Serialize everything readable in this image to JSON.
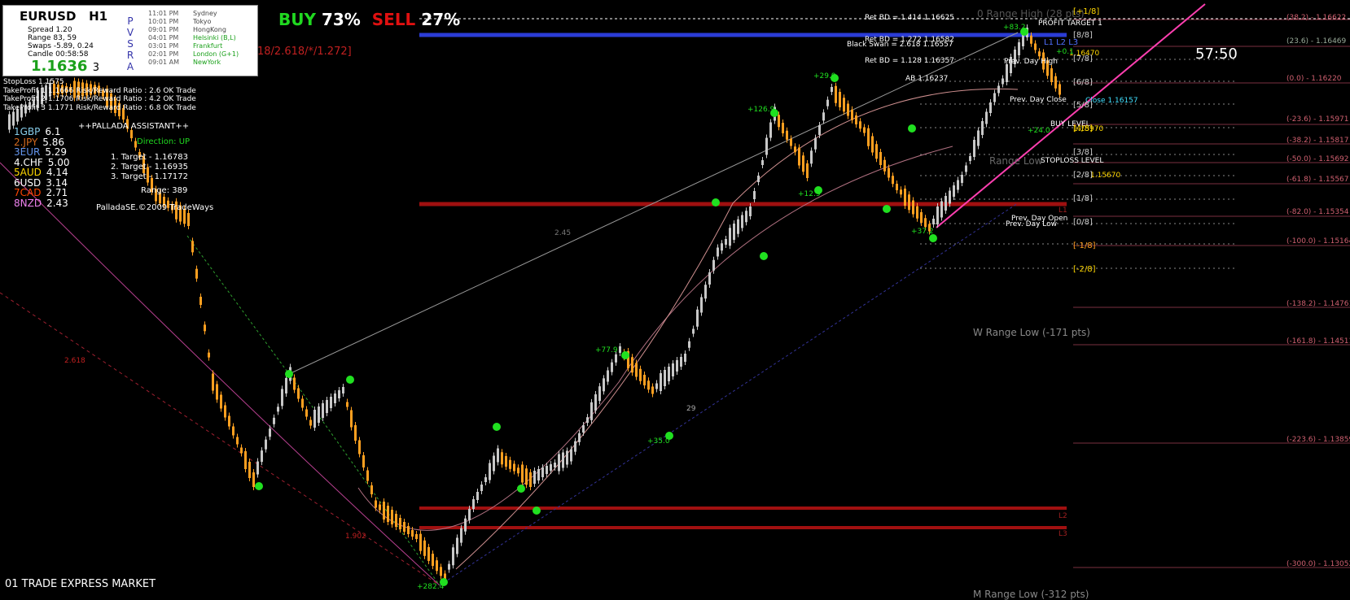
{
  "panel": {
    "symbol": "EURUSD",
    "timeframe": "H1",
    "spread": "Spread   1.20",
    "range": "Range    83, 59",
    "swaps": "Swaps   -5.89, 0.24",
    "candle": "Candle   00:58:58",
    "price": "1.1636",
    "price_digit": "3",
    "pvsra": [
      "P",
      "V",
      "S",
      "R",
      "A"
    ],
    "sessions": [
      {
        "time": "11:01 PM",
        "city": "Sydney",
        "color": "#444"
      },
      {
        "time": "10:01 PM",
        "city": "Tokyo",
        "color": "#444"
      },
      {
        "time": "09:01 PM",
        "city": "HongKong",
        "color": "#444"
      },
      {
        "time": "04:01 PM",
        "city": "Helsinki  (B,L)",
        "color": "#1aa01a"
      },
      {
        "time": "03:01 PM",
        "city": "Frankfurt",
        "color": "#1aa01a"
      },
      {
        "time": "02:01 PM",
        "city": "London  (G+1)",
        "color": "#1aa01a"
      },
      {
        "time": "09:01 AM",
        "city": "NewYork",
        "color": "#1aa01a"
      }
    ]
  },
  "sentiment": {
    "buy": "BUY",
    "buy_pct": "73%",
    "sell": "SELL",
    "sell_pct": "27%"
  },
  "fib_text": "18/2.618/*/1.272]",
  "assistant": {
    "stoploss": "StopLoss 1.1575",
    "tp1": "TakeProfit 1 1.1666 Risk/Reward Ratio : 2.6 OK Trade",
    "tp2": "TakeProfit 2 1.1706 Risk/Reward Ratio : 4.2 OK Trade",
    "tp3": "TakeProfit 3 1.1771 Risk/Reward Ratio : 6.8 OK Trade",
    "title": "++PALLADA ASSISTANT++",
    "direction": "Direction: UP",
    "targets": [
      "1. Target - 1.16783",
      "2. Target - 1.16935",
      "3. Target - 1.17172"
    ],
    "range": "Range: 389",
    "credit": "PalladaSE.©2009 TradeWays"
  },
  "currencies": [
    {
      "name": "1GBP",
      "val": "6.1",
      "color": "#87ceeb"
    },
    {
      "name": "2.JPY",
      "val": "5.86",
      "color": "#d2691e"
    },
    {
      "name": "3EUR",
      "val": "5.29",
      "color": "#6495ed"
    },
    {
      "name": "4.CHF",
      "val": "5.00",
      "color": "#ffffff"
    },
    {
      "name": "5AUD",
      "val": "4.14",
      "color": "#ffd700"
    },
    {
      "name": "6USD",
      "val": "3.14",
      "color": "#ffffff"
    },
    {
      "name": "7CAD",
      "val": "2.71",
      "color": "#ff4500"
    },
    {
      "name": "8NZD",
      "val": "2.43",
      "color": "#ee82ee"
    }
  ],
  "clock": "57:50",
  "footer": "01 TRADE EXPRESS MARKET",
  "levels": {
    "ret1": "Ret BD = 1.414  1.16625",
    "ret2": "Ret BD = 1.272  1.16582",
    "swan": "Black Swan = 2.618  1.16557",
    "ret3": "Ret BD = 1.128  1.16357",
    "ab": "AB  1.16237",
    "profit_target": "PROFIT TARGET 1",
    "range_high": "0 Range High (28 pts)",
    "prev_high": "Prev. Day High",
    "prev_close": "Prev. Day Close",
    "close": "Close 1.16157",
    "buy_level": "BUY LEVEL",
    "stop_level": "STOPLOSS LEVEL",
    "range_low": "Range Low",
    "prev_open": "Prev. Day Open",
    "prev_low": "Prev. Day Low",
    "w_range_low": "W Range Low (-171 pts)",
    "m_range_low": "M Range Low (-312 pts)",
    "l1l2l3": "L1 L2 L3",
    "l1": "L1",
    "l2": "L2",
    "l3": "L3",
    "val_1647": "1.16470",
    "val_1597": "1.15970",
    "val_1567": "1.15670"
  },
  "octaves": [
    "[+1/8]",
    "[8/8]",
    "[7/8]",
    "[6/8]",
    "[5/8]",
    "[4/8]",
    "[3/8]",
    "[2/8]",
    "[1/8]",
    "[0/8]",
    "[-1/8]",
    "[-2/8]"
  ],
  "fib_right": [
    "(38.2) - 1.16622",
    "(23.6) - 1.16469",
    "(0.0) - 1.16220",
    "(-23.6) - 1.15971",
    "(-38.2) - 1.15817",
    "(-50.0) - 1.15692",
    "(-61.8) - 1.15567",
    "(-82.0) - 1.15354",
    "(-100.0) - 1.15164",
    "(-138.2) - 1.14761",
    "(-161.8) - 1.14511",
    "(-223.6) - 1.13859",
    "(-300.0) - 1.13052"
  ],
  "chart_labels": [
    "+29.9",
    "+126.9",
    "+12.9",
    "+37.2",
    "+24.0",
    "+83.2",
    "+77.9",
    "+35.0",
    "+282.4",
    "+0.1",
    "2.45",
    "2.618",
    "1.902",
    "29"
  ],
  "colors": {
    "bull": "#ffa020",
    "bear": "#c8c8c8",
    "red_zone": "#b01010",
    "blue_line": "#2b3cd6",
    "magenta": "#ff3fb0"
  }
}
